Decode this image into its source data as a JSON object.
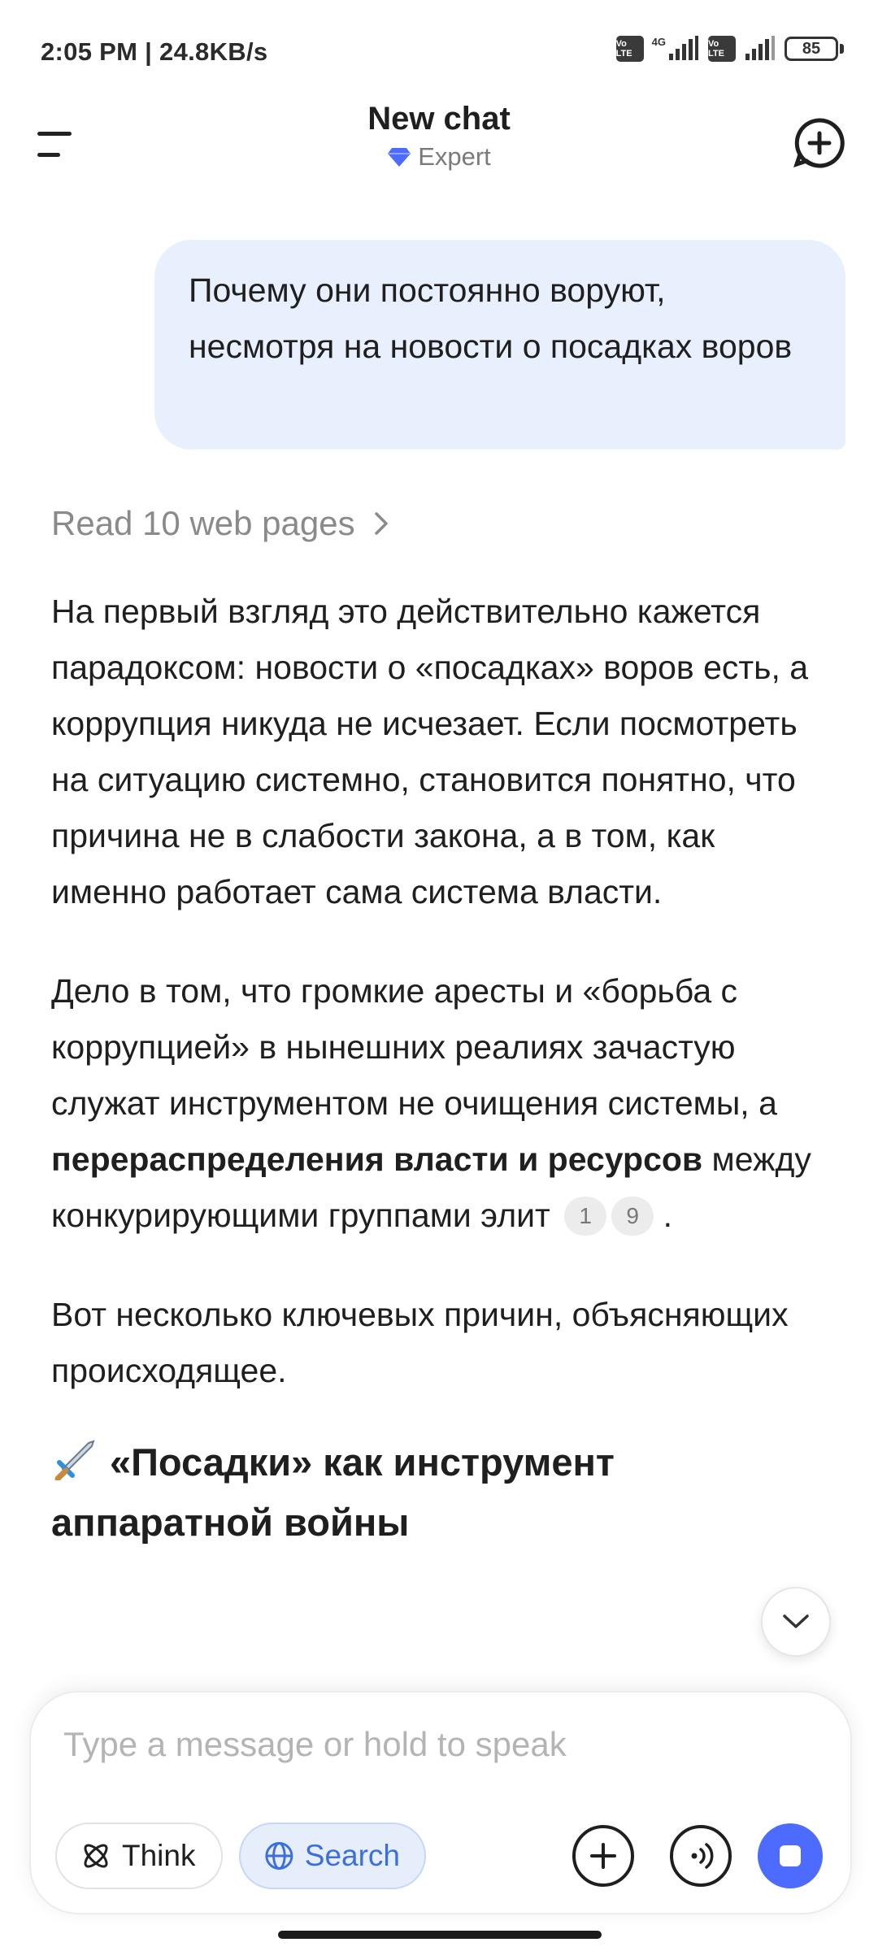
{
  "status_bar": {
    "time": "2:05 PM | 24.8KB/s",
    "volte_1": "Vo LTE",
    "network_type": "4G",
    "volte_2": "Vo LTE",
    "battery": "85"
  },
  "header": {
    "title": "New chat",
    "subtitle": "Expert",
    "subtitle_icon": "diamond-icon",
    "accent_color": "#4d6bfe"
  },
  "user_message": {
    "text": "Почему они постоянно воруют, несмотря на новости о посадках воров"
  },
  "read_pages": {
    "label": "Read 10 web pages"
  },
  "answer": {
    "p1": "На первый взгляд это действительно кажется парадоксом: новости о «посадках» воров есть, а коррупция никуда не исчезает. Если посмотреть на ситуацию системно, становится понятно, что причина не в слабости закона, а в том, как именно работает сама система власти.",
    "p2_start": "Дело в том, что громкие аресты и «борьба с коррупцией» в нынешних реалиях зачастую служат инструментом не очищения системы, а ",
    "p2_bold": "перераспределения власти и ресурсов",
    "p2_end": " между конкурирующими группами элит",
    "citation_1": "1",
    "citation_2": "9",
    "p2_tail": ".",
    "p3": "Вот несколько ключевых причин, объясняющих происходящее.",
    "heading_emoji": "dagger-icon",
    "heading": "«Посадки» как инструмент аппаратной войны"
  },
  "composer": {
    "placeholder": "Type a message or hold to speak",
    "think_label": "Think",
    "search_label": "Search"
  }
}
